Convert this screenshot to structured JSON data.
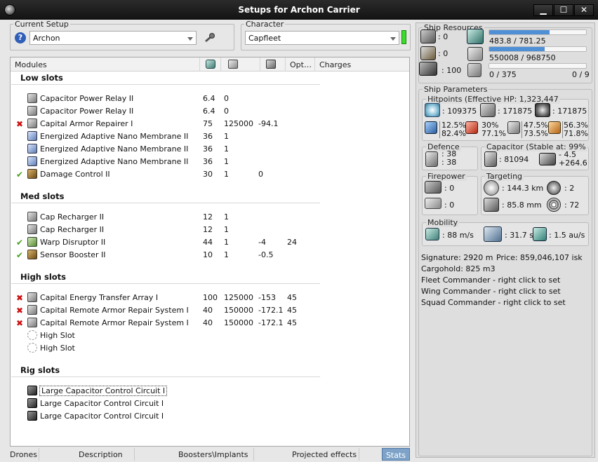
{
  "window": {
    "title": "Setups for Archon Carrier",
    "min": "▁",
    "max": "☐",
    "close": "✕"
  },
  "current_setup": {
    "legend": "Current Setup",
    "value": "Archon"
  },
  "character": {
    "legend": "Character",
    "value": "Capfleet"
  },
  "modules": {
    "headers": {
      "modules": "Modules",
      "opt": "Opt…",
      "charges": "Charges"
    },
    "sections": [
      {
        "title": "Low slots",
        "rows": [
          {
            "mark": "",
            "icon": "gray",
            "name": "Capacitor Power Relay II",
            "c1": "6.4",
            "c2": "0",
            "c3": "",
            "c4": ""
          },
          {
            "mark": "",
            "icon": "gray",
            "name": "Capacitor Power Relay II",
            "c1": "6.4",
            "c2": "0",
            "c3": "",
            "c4": ""
          },
          {
            "mark": "x",
            "icon": "gray",
            "name": "Capital Armor Repairer I",
            "c1": "75",
            "c2": "125000",
            "c3": "-94.1",
            "c4": ""
          },
          {
            "mark": "",
            "icon": "blue",
            "name": "Energized Adaptive Nano Membrane II",
            "c1": "36",
            "c2": "1",
            "c3": "",
            "c4": ""
          },
          {
            "mark": "",
            "icon": "blue",
            "name": "Energized Adaptive Nano Membrane II",
            "c1": "36",
            "c2": "1",
            "c3": "",
            "c4": ""
          },
          {
            "mark": "",
            "icon": "blue",
            "name": "Energized Adaptive Nano Membrane II",
            "c1": "36",
            "c2": "1",
            "c3": "",
            "c4": ""
          },
          {
            "mark": "ok",
            "icon": "brown",
            "name": "Damage Control II",
            "c1": "30",
            "c2": "1",
            "c3": "0",
            "c4": ""
          }
        ]
      },
      {
        "title": "Med slots",
        "rows": [
          {
            "mark": "",
            "icon": "gray",
            "name": "Cap Recharger II",
            "c1": "12",
            "c2": "1",
            "c3": "",
            "c4": ""
          },
          {
            "mark": "",
            "icon": "gray",
            "name": "Cap Recharger II",
            "c1": "12",
            "c2": "1",
            "c3": "",
            "c4": ""
          },
          {
            "mark": "ok",
            "icon": "green",
            "name": "Warp Disruptor II",
            "c1": "44",
            "c2": "1",
            "c3": "-4",
            "c4": "24"
          },
          {
            "mark": "ok",
            "icon": "brown",
            "name": "Sensor Booster II",
            "c1": "10",
            "c2": "1",
            "c3": "-0.5",
            "c4": ""
          }
        ]
      },
      {
        "title": "High slots",
        "rows": [
          {
            "mark": "x",
            "icon": "gray",
            "name": "Capital Energy Transfer Array I",
            "c1": "100",
            "c2": "125000",
            "c3": "-153",
            "c4": "45"
          },
          {
            "mark": "x",
            "icon": "gray",
            "name": "Capital Remote Armor Repair System I",
            "c1": "40",
            "c2": "150000",
            "c3": "-172.1",
            "c4": "45"
          },
          {
            "mark": "x",
            "icon": "gray",
            "name": "Capital Remote Armor Repair System I",
            "c1": "40",
            "c2": "150000",
            "c3": "-172.1",
            "c4": "45"
          },
          {
            "mark": "",
            "icon": "ghost",
            "name": "High Slot",
            "c1": "",
            "c2": "",
            "c3": "",
            "c4": ""
          },
          {
            "mark": "",
            "icon": "ghost",
            "name": "High Slot",
            "c1": "",
            "c2": "",
            "c3": "",
            "c4": ""
          }
        ]
      },
      {
        "title": "Rig slots",
        "rows": [
          {
            "mark": "",
            "icon": "dark",
            "name": "Large Capacitor Control Circuit I",
            "c1": "",
            "c2": "",
            "c3": "",
            "c4": ""
          },
          {
            "mark": "",
            "icon": "dark",
            "name": "Large Capacitor Control Circuit I",
            "c1": "",
            "c2": "",
            "c3": "",
            "c4": ""
          },
          {
            "mark": "",
            "icon": "dark",
            "name": "Large Capacitor Control Circuit I",
            "c1": "",
            "c2": "",
            "c3": "",
            "c4": ""
          }
        ]
      }
    ]
  },
  "tabs": [
    "Drones",
    "Description",
    "Boosters\\Implants",
    "Projected effects",
    "Stats"
  ],
  "resources": {
    "legend": "Ship Resources",
    "turrets": ": 0",
    "launchers": ": 0",
    "drone_bw": ": 100",
    "cpu": "483.8 / 781.25",
    "cpu_fill": 0.62,
    "pg": "550008 / 968750",
    "pg_fill": 0.57,
    "calibration": "0 / 375",
    "calibration_fill": 0,
    "drones": "0 / 9"
  },
  "params": {
    "legend": "Ship Parameters",
    "hitpoints_legend": "Hitpoints (Effective HP: 1,323,447",
    "shield_hp": ": 109375",
    "armor_hp": ": 171875",
    "structure_hp": ": 171875",
    "em": [
      "12.5%",
      "82.4%"
    ],
    "thermal": [
      "30%",
      "77.1%"
    ],
    "kinetic": [
      "47.5%",
      "73.5%"
    ],
    "explosive": [
      "56.3%",
      "71.8%"
    ],
    "defence_legend": "Defence",
    "defence": [
      ": 38",
      ": 38"
    ],
    "capacitor_legend": "Capacitor (Stable at: 99%",
    "cap_amount": ": 81094",
    "cap_delta": [
      "- 4.5",
      "+264.6"
    ],
    "firepower_legend": "Firepower",
    "firepower": [
      ": 0",
      ": 0"
    ],
    "targeting_legend": "Targeting",
    "range": ": 144.3 km",
    "max_targets": ": 2",
    "scan_res": ": 85.8 mm",
    "sensor": ": 72",
    "mobility_legend": "Mobility",
    "speed": ": 88 m/s",
    "align": ": 31.7 s",
    "warp": ": 1.5 au/s",
    "signature": "Signature: 2920 m",
    "price": "Price: 859,046,107 isk",
    "cargohold": "Cargohold: 825 m3",
    "fleet_cmd": "Fleet Commander - right click to set",
    "wing_cmd": "Wing Commander - right click to set",
    "squad_cmd": "Squad Commander - right click to set"
  },
  "colors": {
    "accent": "#4f8fd6",
    "error": "#cc1111",
    "ok": "#4aa020"
  }
}
